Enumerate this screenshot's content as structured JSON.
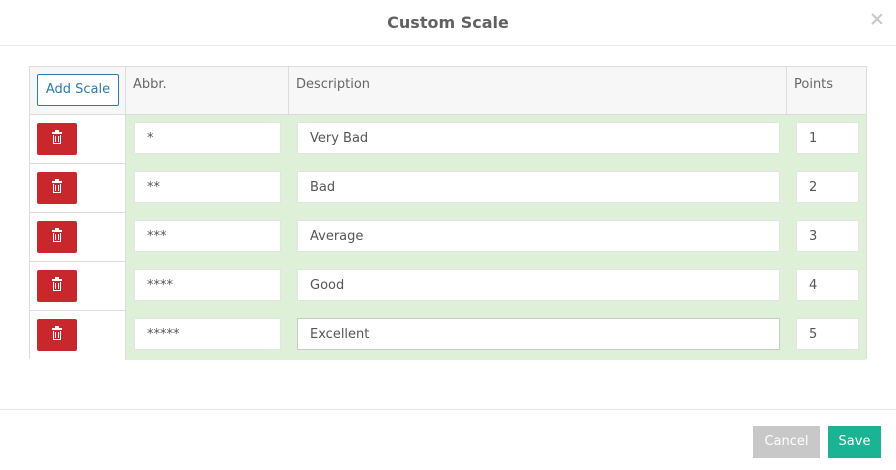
{
  "modal": {
    "title": "Custom Scale"
  },
  "table": {
    "add_label": "Add Scale",
    "columns": [
      "",
      "Abbr.",
      "Description",
      "Points"
    ],
    "rows": [
      {
        "abbr": "*",
        "description": "Very Bad",
        "points": "1"
      },
      {
        "abbr": "**",
        "description": "Bad",
        "points": "2"
      },
      {
        "abbr": "***",
        "description": "Average",
        "points": "3"
      },
      {
        "abbr": "****",
        "description": "Good",
        "points": "4"
      },
      {
        "abbr": "*****",
        "description": "Excellent",
        "points": "5"
      }
    ]
  },
  "footer": {
    "cancel_label": "Cancel",
    "save_label": "Save"
  },
  "colors": {
    "delete": "#c8282c",
    "row_highlight": "#dff0d8",
    "save": "#1ab394",
    "cancel": "#c8c8c8",
    "add_scale": "#2a7ab0"
  },
  "icons": {
    "close": "close-icon",
    "delete": "trash-icon"
  }
}
